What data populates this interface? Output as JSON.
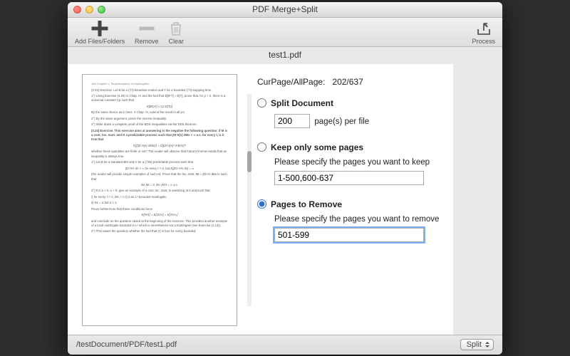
{
  "window": {
    "title": "PDF Merge+Split"
  },
  "toolbar": {
    "add": "Add Files/Folders",
    "remove": "Remove",
    "clear": "Clear",
    "process": "Process"
  },
  "document": {
    "title": "test1.pdf",
    "page_info_label": "CurPage/AllPage:",
    "page_info_value": "202/637"
  },
  "options": {
    "split": {
      "label": "Split  Document",
      "value": "200",
      "suffix": "page(s) per file"
    },
    "keep": {
      "label": "Keep only some pages",
      "hint": "Please specify the pages you want to keep",
      "value": "1-500,600-637"
    },
    "remove": {
      "label": "Pages to Remove",
      "hint": "Please specify the pages you want to remove",
      "value": "501-599"
    },
    "selected": "remove"
  },
  "footer": {
    "path": "/testDocument/PDF/test1.pdf",
    "action": "Split"
  },
  "preview": {
    "header": "188     Chapter V. Representation of Martingales",
    "lines": [
      "(3.23) Exercise. Let B be a (ℱt)-Brownian motion and T be a bounded (ℱt)-stopping time.",
      "1°) Using Exercise (4.25) in Chap. IV and the fact that E[B²T] = E[T], prove that, for p > 2, there is a universal constant Cp such that",
      "E[B²pT] ≤ Cp E[Tp]",
      "By the same device as in Sect. 4 Chap. IV, extend the result to all p's.",
      "2°) By the same argument, prove the reverse inequality.",
      "3°) Write down a complete proof of the BDG inequalities via the DDS theorem.",
      "# (3.24) Exercise. This exercise aims at answering in the negative the following question: if M is a cont. loc. mart. and H a predictable process such that ∫0t H(s) dMs < ∞ a.s. for every t, is it true that",
      "E[(∫0t H(s) dMs)²] = E[∫0t H(s)² d⟨M⟩s]?",
      "whether these quantities are finite or not? The reader will observe that Fatou's lemma entails that an inequality is always true.",
      "1°) Let B be a standard BM and H be a (ℱtB)-predictable process such that",
      "∫0t H²s ds < ∞  for every t > 0,  but  E[∫01 H²s ds] = ∞",
      "(the reader will provide simple examples of such H). Prove that the loc. mart. Mt = ∫0t Hs dBs is such that",
      "lim Mt = 0,   lim ⟨M⟩t = ∞ a.s.",
      "2°) For a > 0, α > 0, give an example of a cont. loc. mart. N vanishing at 0 and such that",
      "i) for every τ > 1, (Nt, τ ≥ t) is an L²-bounded martingale;",
      "ii) N1 = α but α ≥ 1.",
      "Prove furthermore that these conditions force",
      "E[N²1] = E[⟨N⟩1] = E[⟨N⟩∞]",
      "and conclude on the question raised at the beginning of the exercise. This provides another example of a local martingale bounded in L² which is nevertheless not a martingale (see Exercise (2.13)).",
      "3°) This raises the question whether the fact that (•) is true for every bounded"
    ]
  }
}
